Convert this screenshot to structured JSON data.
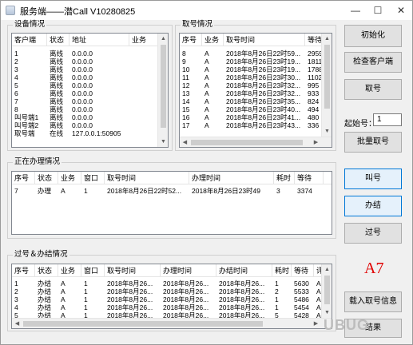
{
  "window": {
    "title": "服务端——潜Call V10280825",
    "min_glyph": "—",
    "max_glyph": "☐",
    "close_glyph": "✕"
  },
  "device_panel": {
    "title": "设备情况",
    "columns": [
      "客户端",
      "状态",
      "地址",
      "业务"
    ],
    "rows": [
      [
        "1",
        "离线",
        "0.0.0.0",
        ""
      ],
      [
        "2",
        "离线",
        "0.0.0.0",
        ""
      ],
      [
        "3",
        "离线",
        "0.0.0.0",
        ""
      ],
      [
        "4",
        "离线",
        "0.0.0.0",
        ""
      ],
      [
        "5",
        "离线",
        "0.0.0.0",
        ""
      ],
      [
        "6",
        "离线",
        "0.0.0.0",
        ""
      ],
      [
        "7",
        "离线",
        "0.0.0.0",
        ""
      ],
      [
        "8",
        "离线",
        "0.0.0.0",
        ""
      ],
      [
        "叫号端1",
        "离线",
        "0.0.0.0",
        ""
      ],
      [
        "叫号端2",
        "离线",
        "0.0.0.0",
        ""
      ],
      [
        "取号端",
        "在线",
        "127.0.0.1:50905",
        ""
      ]
    ]
  },
  "ticket_panel": {
    "title": "取号情况",
    "columns": [
      "序号",
      "业务",
      "取号时间",
      "等待"
    ],
    "rows": [
      [
        "8",
        "A",
        "2018年8月26日22时59...",
        "2959"
      ],
      [
        "9",
        "A",
        "2018年8月26日23时19...",
        "1811"
      ],
      [
        "10",
        "A",
        "2018年8月26日23时19...",
        "1788"
      ],
      [
        "11",
        "A",
        "2018年8月26日23时30...",
        "1102"
      ],
      [
        "12",
        "A",
        "2018年8月26日23时32...",
        "995"
      ],
      [
        "13",
        "A",
        "2018年8月26日23时32...",
        "933"
      ],
      [
        "14",
        "A",
        "2018年8月26日23时35...",
        "824"
      ],
      [
        "15",
        "A",
        "2018年8月26日23时40...",
        "494"
      ],
      [
        "16",
        "A",
        "2018年8月26日23时41...",
        "480"
      ],
      [
        "17",
        "A",
        "2018年8月26日23时43...",
        "336"
      ]
    ]
  },
  "processing_panel": {
    "title": "正在办理情况",
    "columns": [
      "序号",
      "状态",
      "业务",
      "窗口",
      "取号时间",
      "办理时间",
      "耗时",
      "等待"
    ],
    "rows": [
      [
        "7",
        "办理",
        "A",
        "1",
        "2018年8月26日22时52...",
        "2018年8月26日23时49",
        "3",
        "3374"
      ]
    ]
  },
  "history_panel": {
    "title": "过号＆办结情况",
    "columns": [
      "序号",
      "状态",
      "业务",
      "窗口",
      "取号时间",
      "办理时间",
      "办结时间",
      "耗时",
      "等待",
      "评"
    ],
    "rows": [
      [
        "1",
        "办结",
        "A",
        "1",
        "2018年8月26...",
        "2018年8月26...",
        "2018年8月26...",
        "1",
        "5630",
        "A"
      ],
      [
        "2",
        "办结",
        "A",
        "1",
        "2018年8月26...",
        "2018年8月26...",
        "2018年8月26...",
        "2",
        "5533",
        "A"
      ],
      [
        "3",
        "办结",
        "A",
        "1",
        "2018年8月26...",
        "2018年8月26...",
        "2018年8月26...",
        "1",
        "5486",
        "A"
      ],
      [
        "4",
        "办结",
        "A",
        "1",
        "2018年8月26...",
        "2018年8月26...",
        "2018年8月26...",
        "1",
        "5454",
        "A"
      ],
      [
        "5",
        "办结",
        "A",
        "1",
        "2018年8月26...",
        "2018年8月26...",
        "2018年8月26...",
        "5",
        "5428",
        "A"
      ]
    ]
  },
  "buttons": {
    "init": "初始化",
    "check_client": "检查客户端",
    "take_number": "取号",
    "batch_take": "批量取号",
    "call_number": "叫号",
    "finish": "办结",
    "skip": "过号",
    "load_info": "载入取号信息",
    "last_partial": "结果"
  },
  "start_number": {
    "label": "起始号：",
    "value": "1"
  },
  "current_number": "A7",
  "watermark": "UBUG"
}
